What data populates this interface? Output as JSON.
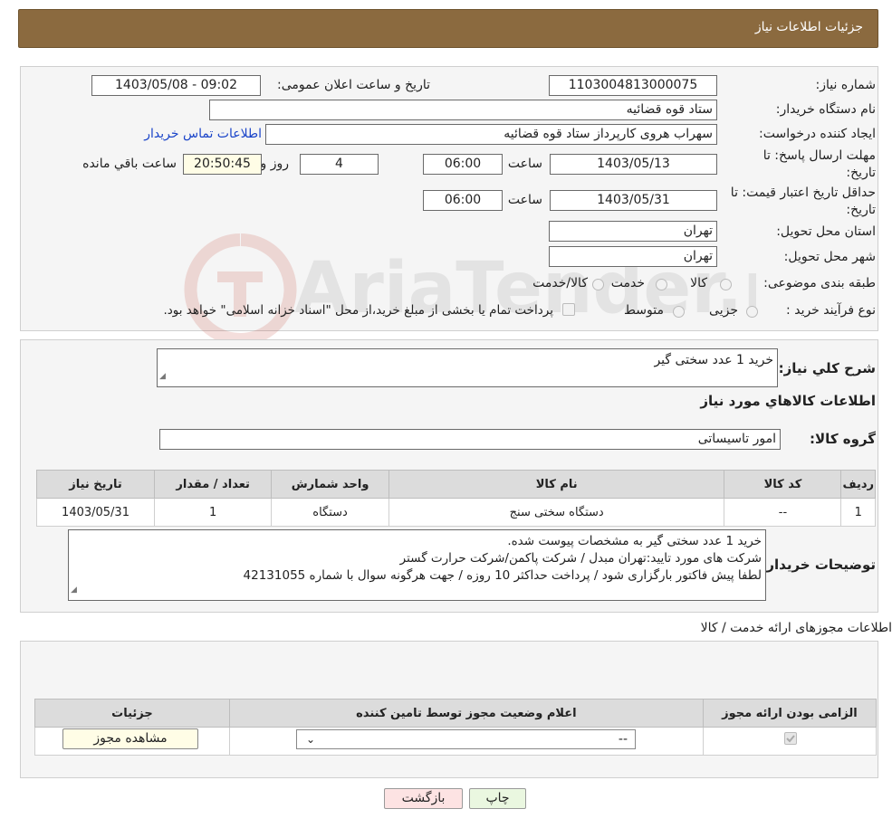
{
  "header": {
    "title": "جزئیات اطلاعات نیاز"
  },
  "watermark": {
    "text": "AriaTender.neT"
  },
  "info": {
    "need_number_label": "شماره نیاز:",
    "need_number": "1103004813000075",
    "announce_label": "تاریخ و ساعت اعلان عمومی:",
    "announce_value": "1403/05/08 - 09:02",
    "buyer_org_label": "نام دستگاه خریدار:",
    "buyer_org": "ستاد قوه قضائیه",
    "creator_label": "ایجاد کننده درخواست:",
    "creator": "سهراب هروی کارپرداز ستاد قوه قضائیه",
    "contact_link": "اطلاعات تماس خریدار",
    "deadline_label_1": "مهلت ارسال پاسخ: تا",
    "deadline_label_2": "تاریخ:",
    "deadline_date": "1403/05/13",
    "time_label": "ساعت",
    "deadline_time": "06:00",
    "days_value": "4",
    "days_label": "روز و",
    "remaining_time": "20:50:45",
    "remaining_label": "ساعت باقي مانده",
    "validity_label_1": "حداقل تاریخ اعتبار قیمت: تا",
    "validity_label_2": "تاریخ:",
    "validity_date": "1403/05/31",
    "validity_time": "06:00",
    "province_label": "استان محل تحویل:",
    "province": "تهران",
    "city_label": "شهر محل تحویل:",
    "city": "تهران",
    "category_label": "طبقه بندی موضوعی:",
    "category_options": [
      "کالا",
      "خدمت",
      "کالا/خدمت"
    ],
    "process_label": "نوع فرآیند خرید :",
    "process_options": [
      "جزیی",
      "متوسط"
    ],
    "process_note": "پرداخت تمام یا بخشی از مبلغ خرید،از محل \"اسناد خزانه اسلامی\" خواهد بود."
  },
  "desc": {
    "summary_label": "شرح کلي نياز:",
    "summary": "خريد 1 عدد سختی گير",
    "goods_title": "اطلاعات كالاهاي مورد نياز",
    "group_label": "گروه کالا:",
    "group": "امور تاسیساتی",
    "table": {
      "headers": [
        "ردیف",
        "کد کالا",
        "نام کالا",
        "واحد شمارش",
        "تعداد / مقدار",
        "تاریخ نیاز"
      ],
      "rows": [
        [
          "1",
          "--",
          "دستگاه سختی سنج",
          "دستگاه",
          "1",
          "1403/05/31"
        ]
      ]
    },
    "buyer_notes_label": "توضیحات خریدار:",
    "buyer_notes": [
      "خرید 1 عدد سختی گیر به مشخصات پیوست شده.",
      "شرکت های مورد تایید:تهران مبدل / شرکت پاکمن/شرکت حرارت گستر",
      "لطفا پیش فاکتور بارگزاری شود / پرداخت حداکثر 10 روزه / جهت هرگونه سوال با شماره 42131055"
    ]
  },
  "permits": {
    "title": "اطلاعات مجوزهای ارائه خدمت / کالا",
    "headers": [
      "الزامی بودن ارائه مجوز",
      "اعلام وضعیت مجوز توسط تامین کننده",
      "جزئیات"
    ],
    "select_value": "--",
    "view_button": "مشاهده مجوز"
  },
  "buttons": {
    "print": "چاپ",
    "back": "بازگشت"
  },
  "colors": {
    "header_bg": "#8b6a3f",
    "link": "#1a44c9",
    "print_bg": "#eaf7e0",
    "back_bg": "#fde3e3"
  }
}
